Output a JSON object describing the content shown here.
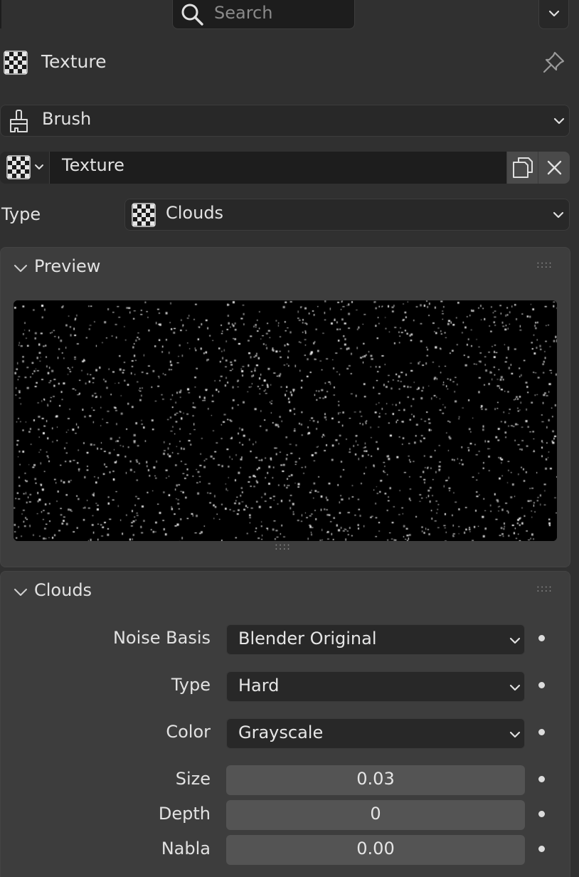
{
  "search": {
    "placeholder": "Search"
  },
  "context": {
    "title": "Texture"
  },
  "brush": {
    "label": "Brush"
  },
  "texture_slot": {
    "name": "Texture"
  },
  "type_row": {
    "label": "Type",
    "value": "Clouds"
  },
  "preview_panel": {
    "title": "Preview"
  },
  "clouds_panel": {
    "title": "Clouds",
    "noise_basis": {
      "label": "Noise Basis",
      "value": "Blender Original"
    },
    "type": {
      "label": "Type",
      "value": "Hard"
    },
    "color": {
      "label": "Color",
      "value": "Grayscale"
    },
    "size": {
      "label": "Size",
      "value": "0.03"
    },
    "depth": {
      "label": "Depth",
      "value": "0"
    },
    "nabla": {
      "label": "Nabla",
      "value": "0.00"
    }
  },
  "colors": {
    "background": "#303030",
    "panel": "#3d3d3d",
    "field": "#282828",
    "field_dark": "#1d1d1d",
    "number_field": "#545454",
    "text": "#e2e2e2"
  },
  "icons": {
    "search": "search-icon",
    "texture": "checker-texture-icon",
    "pin": "pin-icon",
    "brush": "brush-icon",
    "duplicate": "duplicate-icon",
    "close": "close-icon",
    "chevron": "chevron-down-icon"
  }
}
